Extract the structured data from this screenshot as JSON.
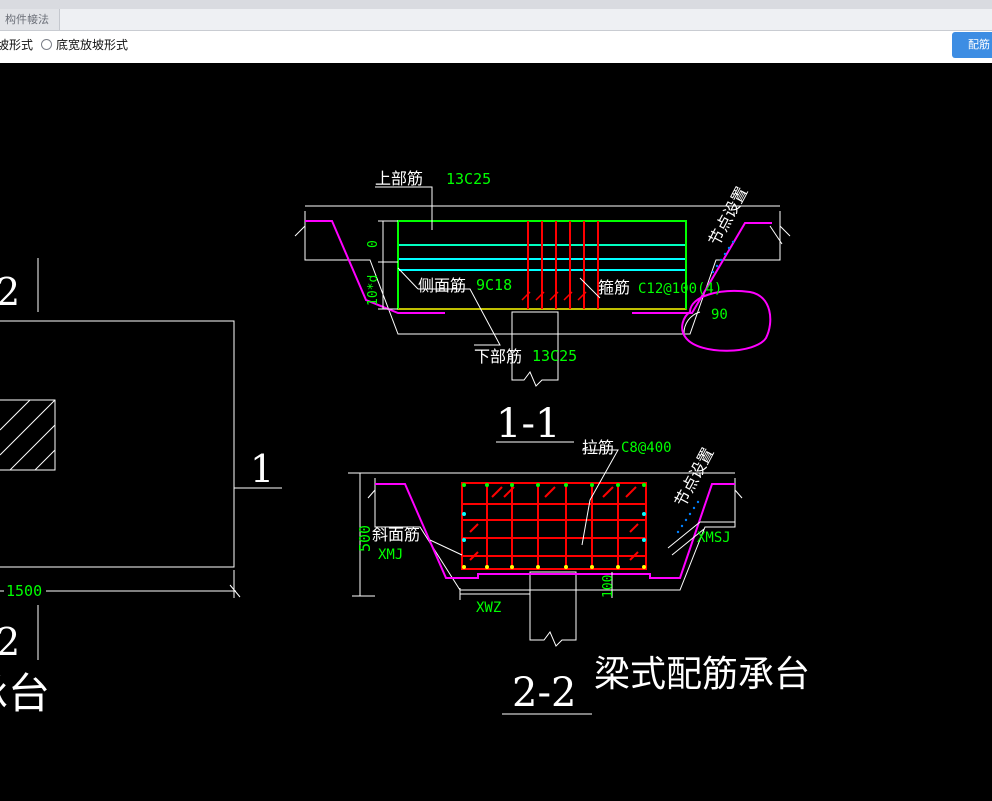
{
  "tab": {
    "label": "构件帹法"
  },
  "options": {
    "slope_form": "坡形式",
    "bottom_wide_slope_form": "底宽放坡形式"
  },
  "rebar_button": "配筋",
  "drawing": {
    "left_panel": {
      "section_mark_top": "2",
      "section_mark_right": "1",
      "section_mark_bottom": "2",
      "dimension_width": "1500",
      "title_fragment": "承台"
    },
    "section_1_1": {
      "label": "1-1",
      "top_rebar_label": "上部筋",
      "top_rebar_value": "13C25",
      "side_rebar_label": "侧面筋",
      "side_rebar_value": "9C18",
      "stirrup_label": "箍筋",
      "stirrup_value": "C12@100(4)",
      "bottom_rebar_label": "下部筋",
      "bottom_rebar_value": "13C25",
      "node_setting": "节点设置",
      "angle": "90",
      "dim_zero": "0",
      "dim_anchor": "10*d"
    },
    "section_2_2": {
      "label": "2-2",
      "tie_label": "拉筋",
      "tie_value": "C8@400",
      "node_setting": "节点设置",
      "slope_rebar_label": "斜面筋",
      "xmj": "XMJ",
      "xmsj": "XMSJ",
      "xwz": "XWZ",
      "height": "500",
      "dim_100": "100"
    },
    "title": "梁式配筋承台"
  },
  "colors": {
    "white": "#ffffff",
    "green": "#00ff00",
    "cyan": "#00ffff",
    "yellow": "#ffff00",
    "red": "#ff0000",
    "magenta": "#ff00ff"
  }
}
